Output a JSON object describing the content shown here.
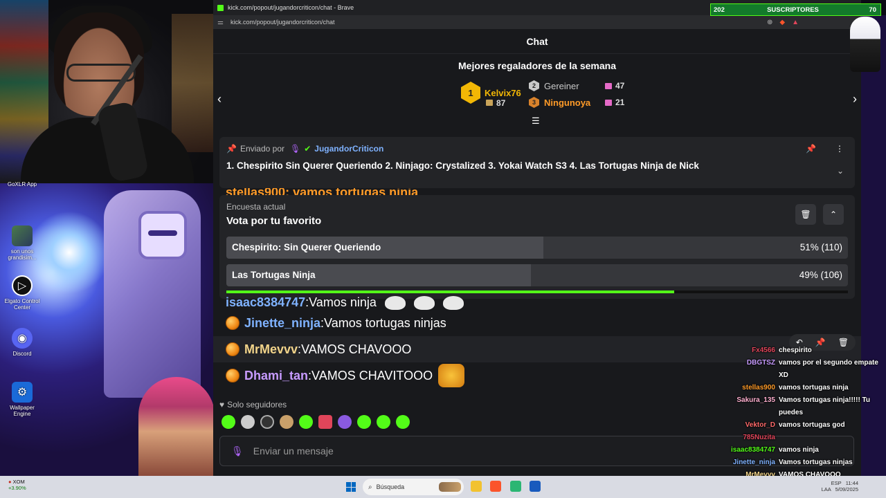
{
  "browser": {
    "title": "kick.com/popout/jugandorcriticon/chat - Brave",
    "url": "kick.com/popout/jugandorcriticon/chat"
  },
  "chat": {
    "header": "Chat",
    "gifters_title": "Mejores regaladores de la semana",
    "gifters": [
      {
        "rank": "1",
        "name": "Kelvix76",
        "count": "87"
      },
      {
        "rank": "2",
        "name": "Gereiner",
        "count": "47"
      },
      {
        "rank": "3",
        "name": "Ningunoya",
        "count": "21"
      }
    ],
    "pinned": {
      "sent_by": "Enviado por",
      "user": "JugandorCriticon",
      "text": "1. Chespirito Sin Querer Queriendo 2. Ninjago: Crystalized 3. Yokai Watch S3 4. Las Tortugas Ninja de Nick"
    },
    "behind_text": "stellas900: vamos tortugas ninja",
    "poll": {
      "label": "Encuesta actual",
      "question": "Vota por tu favorito",
      "options": [
        {
          "text": "Chespirito: Sin Querer Queriendo",
          "percent_label": "51% (110)",
          "percent": 51
        },
        {
          "text": "Las Tortugas Ninja",
          "percent_label": "49% (106)",
          "percent": 49
        }
      ],
      "time_remaining_fraction": 0.72
    },
    "messages": [
      {
        "user": "isaac8384747",
        "text": "Vamos ninja",
        "color": "#7fb2ff"
      },
      {
        "user": "Jinette_ninja",
        "text": "Vamos tortugas ninjas",
        "color": "#7fb2ff"
      },
      {
        "user": "MrMevvv",
        "text": "VAMOS CHAVOOO",
        "color": "#f2d48a"
      },
      {
        "user": "Dhami_tan",
        "text": "VAMOS CHAVITOOO",
        "color": "#c79bff"
      }
    ],
    "followers_only": "Solo seguidores",
    "input_placeholder": "Enviar un mensaje"
  },
  "overlay": {
    "subscribers": {
      "count": "202",
      "label": "SUSCRIPTORES",
      "goal": "70"
    },
    "chat_feed": [
      {
        "user": "Fx4566",
        "text": "chespirito",
        "color": "#e0455a"
      },
      {
        "user": "DBGTSZ",
        "text": "vamos por el segundo empate XD",
        "color": "#c79bff"
      },
      {
        "user": "stellas900",
        "text": "vamos tortugas ninja",
        "color": "#ff9b28"
      },
      {
        "user": "Sakura_135",
        "text": "Vamos tortugas ninja!!!!! Tu puedes",
        "color": "#ffb0d0"
      },
      {
        "user": "Vektor_D",
        "text": "vamos tortugas god",
        "color": "#ff6a6a"
      },
      {
        "user": "785Nuzita",
        "text": "",
        "color": "#e0455a"
      },
      {
        "user": "isaac8384747",
        "text": "vamos ninja",
        "color": "#53fc18"
      },
      {
        "user": "Jinette_ninja",
        "text": "Vamos tortugas ninjas",
        "color": "#7fb2ff"
      },
      {
        "user": "MrMevvv",
        "text": "VAMOS CHAVOOO",
        "color": "#f2d48a"
      }
    ]
  },
  "desktop": {
    "icons": [
      {
        "label": "GoXLR App"
      },
      {
        "label": "son unos grandisim..."
      },
      {
        "label": "Elgato Control Center"
      },
      {
        "label": "Discord"
      },
      {
        "label": "Wallpaper Engine"
      }
    ]
  },
  "taskbar": {
    "stock_ticker": "XOM",
    "stock_change": "+3.90%",
    "search_placeholder": "Búsqueda",
    "tray_lang": "ESP",
    "tray_layout": "LAA",
    "tray_time": "11:44",
    "tray_date": "5/09/2025"
  }
}
